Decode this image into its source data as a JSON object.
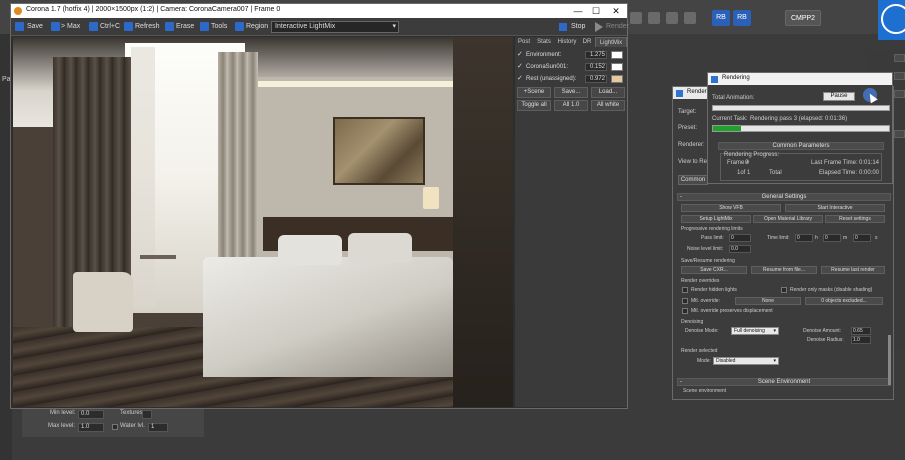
{
  "background": {
    "left_label": "Pa",
    "rb1": "RB",
    "rb2": "RB",
    "cmpp": "CMPP2",
    "bottom_panel": {
      "min_level_label": "Min level:",
      "min_level_value": "0.0",
      "textures_label": "Textures",
      "max_level_label": "Max level:",
      "max_level_value": "1.0",
      "water_label": "Water lvl.",
      "water_value": "1"
    }
  },
  "vfb": {
    "title": "Corona 1.7 (hotfix 4) | 2000×1500px (1:2) | Camera: CoronaCamera007 | Frame 0",
    "window_controls": {
      "minimize": "—",
      "maximize": "☐",
      "close": "✕"
    },
    "toolbar": {
      "save": "Save",
      "to_max": "> Max",
      "ctrl_c": "Ctrl+C",
      "refresh": "Refresh",
      "erase": "Erase",
      "tools": "Tools",
      "region": "Region",
      "mode_select": "Interactive LightMix",
      "stop": "Stop",
      "render": "Render"
    },
    "panel": {
      "tabs": [
        "Post",
        "Stats",
        "History",
        "DR",
        "LightMix"
      ],
      "lights": [
        {
          "label": "Environment:",
          "value": "1.275",
          "color": "#ffffff",
          "checked": "✓"
        },
        {
          "label": "CoronaSun001:",
          "value": "0.152",
          "color": "#ffffff",
          "checked": "✓"
        },
        {
          "label": "Rest (unassigned):",
          "value": "0.972",
          "color": "#e7c9a0",
          "checked": "✓"
        }
      ],
      "buttons_row1": [
        "+Scene",
        "Save...",
        "Load..."
      ],
      "buttons_row2": [
        "Toggle all",
        "All 1.0",
        "All white"
      ]
    }
  },
  "render_setup": {
    "title": "Render",
    "target_label": "Target:",
    "preset_label": "Preset:",
    "renderer_label": "Renderer:",
    "view_label": "View to Ren:",
    "common_tab": "Common",
    "general_settings": "General Settings",
    "show_vfb": "Show VFB",
    "start_interactive": "Start Interactive",
    "setup_lightmix": "Setup LightMix",
    "open_material_library": "Open Material Library",
    "reset_settings": "Reset settings",
    "progressive_limits": "Progressive rendering limits",
    "pass_limit_label": "Pass limit:",
    "pass_limit_value": "0",
    "time_limit_label": "Time limit:",
    "time_h_value": "0",
    "time_h_unit": "h",
    "time_m_value": "0",
    "time_m_unit": "m",
    "time_s_value": "0",
    "time_s_unit": "s",
    "noise_limit_label": "Noise level limit:",
    "noise_limit_value": "0.0",
    "save_resume": "Save/Resume rendering",
    "save_cxr": "Save CXR...",
    "resume_from_file": "Resume from file...",
    "resume_last": "Resume last render",
    "render_overrides": "Render overrides",
    "render_hidden_lights": "Render hidden lights",
    "render_only_masks": "Render only masks (disable shading)",
    "mtl_override": "Mtl. override:",
    "mtl_none": "None",
    "objects_excluded": "0 objects excluded...",
    "mtl_override_displacement": "Mtl. override preserves displacement",
    "denoising": "Denoising",
    "denoise_mode_label": "Denoise Mode:",
    "denoise_mode_value": "Full denoising",
    "denoise_amount_label": "Denoise Amount:",
    "denoise_amount_value": "0.65",
    "denoise_radius_label": "Denoise Radius:",
    "denoise_radius_value": "1.0",
    "render_selected": "Render selected",
    "mode_label": "Mode:",
    "mode_value": "Disabled",
    "scene_environment": "Scene Environment",
    "scene_environment_sub": "Scene environment"
  },
  "rendering_progress": {
    "title": "Rendering",
    "total_animation": "Total Animation:",
    "pause": "Pause",
    "current_task_label": "Current Task:",
    "current_task_value": "Rendering pass 3 (elapsed: 0:01:36)",
    "progress_fraction": 0.16,
    "common_parameters": "Common Parameters",
    "rendering_progress_label": "Rendering Progress:",
    "frame_label": "Frame #",
    "frame_value": "0",
    "of_label": "1of 1",
    "total_label": "Total",
    "last_frame_time_label": "Last Frame Time:",
    "last_frame_time_value": "0:01:14",
    "elapsed_time_label": "Elapsed Time:",
    "elapsed_time_value": "0:00:00"
  }
}
